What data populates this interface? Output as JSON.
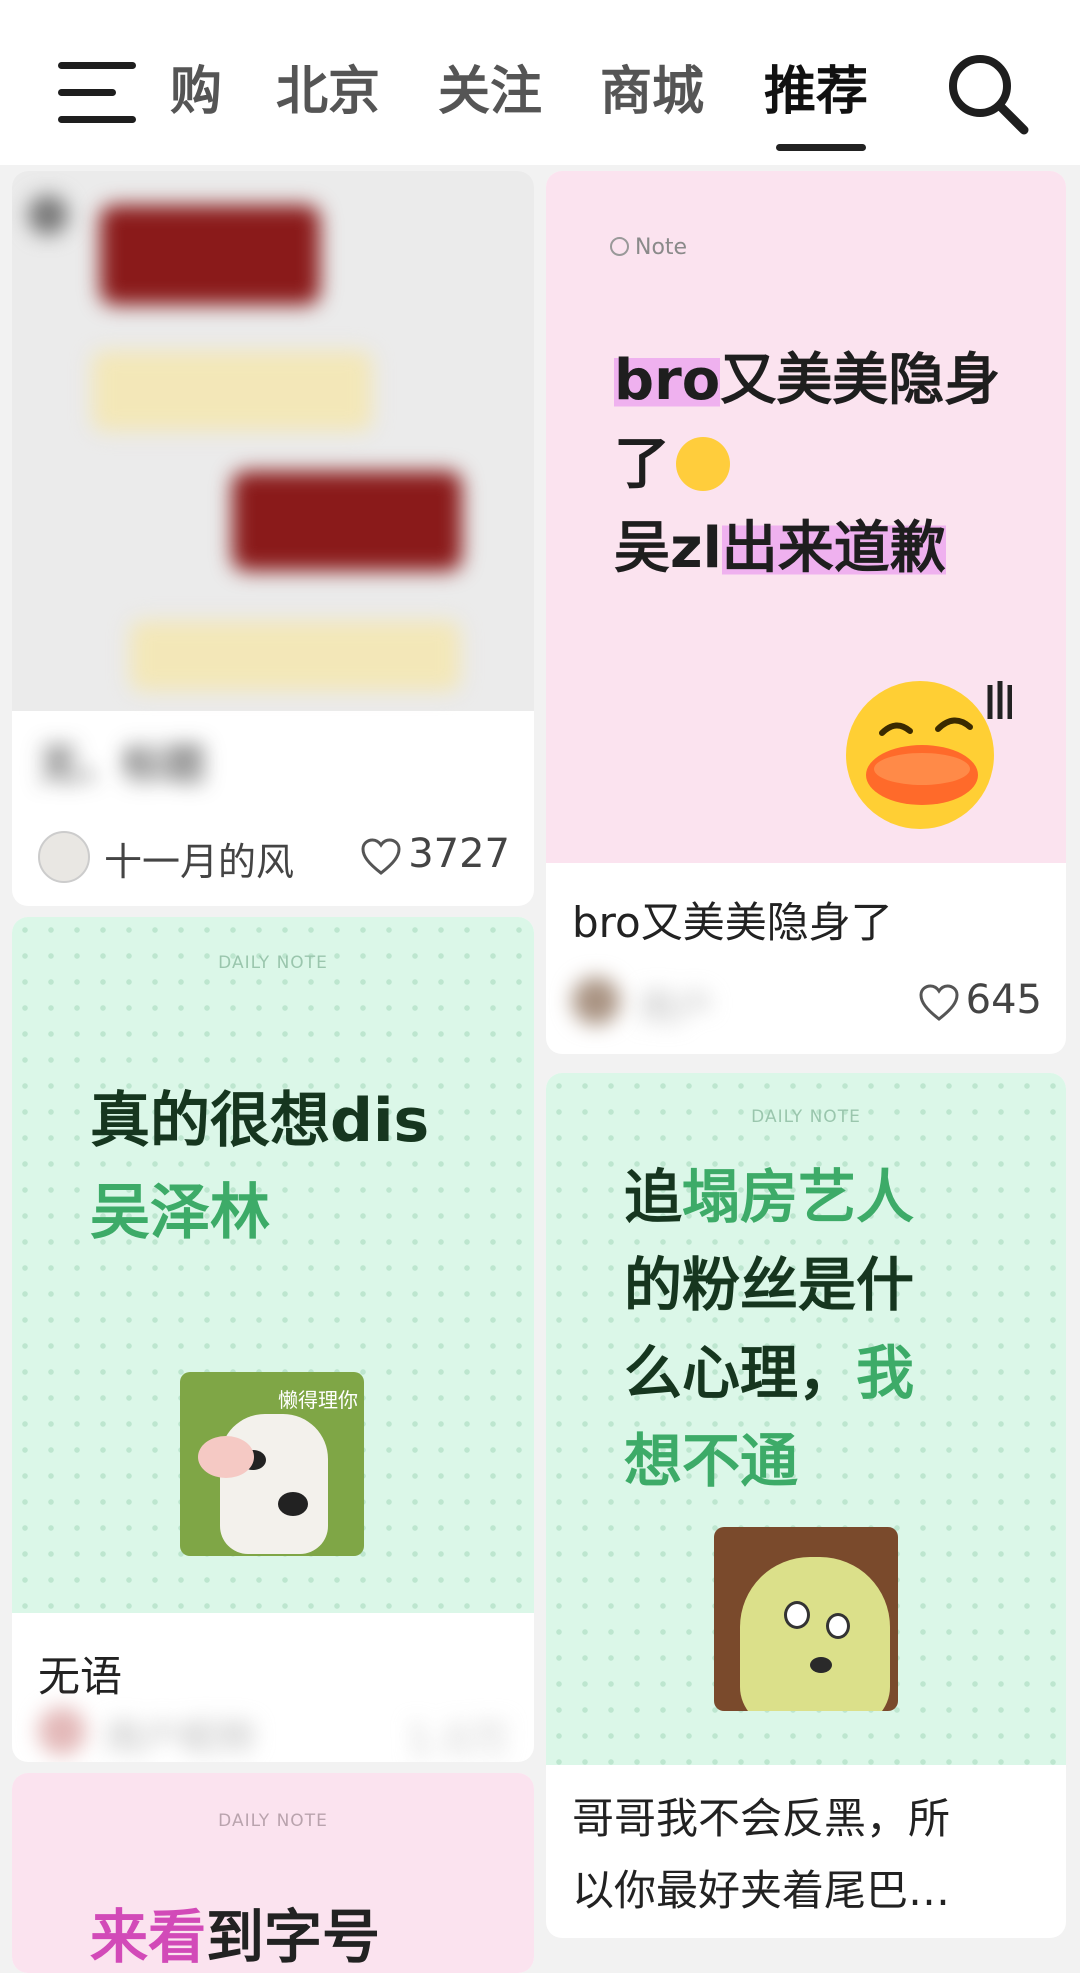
{
  "nav": {
    "tabs": [
      {
        "label": "购"
      },
      {
        "label": "北京"
      },
      {
        "label": "关注"
      },
      {
        "label": "商城"
      },
      {
        "label": "推荐"
      }
    ],
    "active_tab": "推荐"
  },
  "cards": [
    {
      "title": "无、标题",
      "author": "十一月的风",
      "likes": "3727"
    },
    {
      "cover": {
        "tag": "Note",
        "line1_highlight": "bro",
        "line1_rest": "又美美隐身",
        "line2": "了",
        "line3_plain": "吴zl",
        "line3_highlight": "出来道歉"
      },
      "title": "bro又美美隐身了",
      "author": "用户",
      "likes": "645"
    },
    {
      "cover": {
        "tag": "DAILY NOTE",
        "line1": "真的很想dis",
        "line2": "吴泽林",
        "sticker_text": "懒得理你"
      },
      "title": "无语",
      "author": "用户昵称",
      "likes": "1.0万"
    },
    {
      "cover": {
        "tag": "DAILY NOTE",
        "l1_a": "追",
        "l1_b": "塌房艺人",
        "l2": "的粉丝是什",
        "l3_a": "么心理，",
        "l3_b": "我",
        "l4": "想不通"
      },
      "title_line1": "哥哥我不会反黑，所",
      "title_line2": "以你最好夹着尾巴…"
    },
    {
      "cover": {
        "tag": "DAILY NOTE",
        "line_a": "来看",
        "line_b": "到字号"
      }
    }
  ],
  "colors": {
    "pink_bg": "#fbe3ef",
    "mint_bg": "#dbf7e8",
    "highlight": "#efb1ef",
    "green_text": "#3dab68"
  }
}
